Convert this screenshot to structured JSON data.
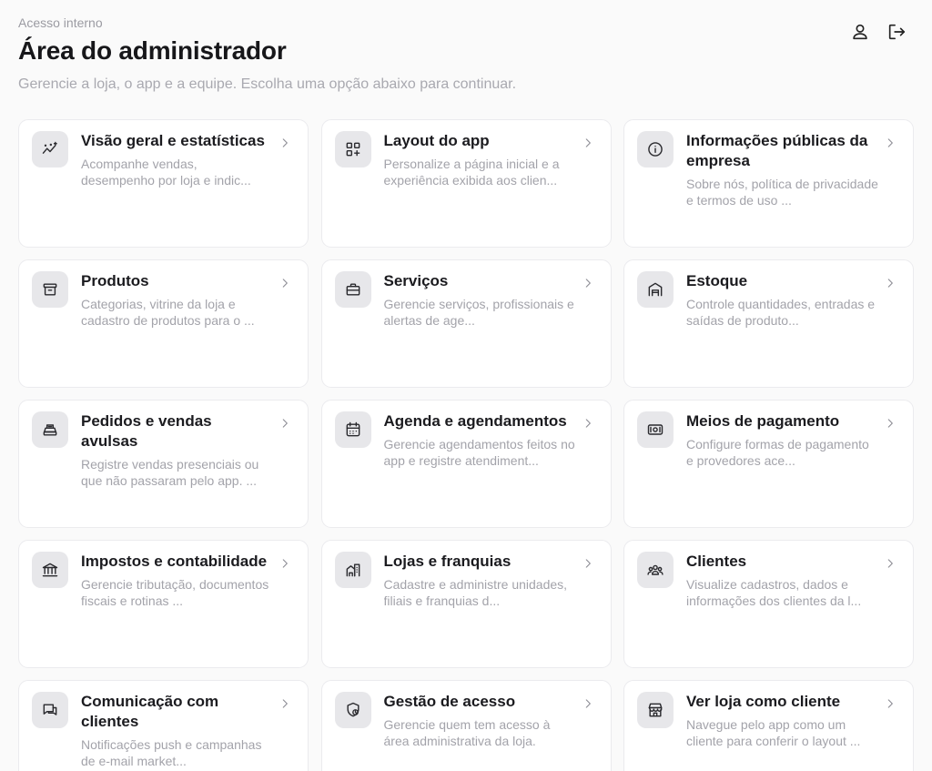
{
  "header": {
    "eyebrow": "Acesso interno",
    "title": "Área do administrador",
    "subtitle": "Gerencie a loja, o app e a equipe. Escolha uma opção abaixo para continuar."
  },
  "cards": [
    {
      "title": "Visão geral e estatísticas",
      "description": "Acompanhe vendas, desempenho por loja e indic...",
      "icon": "chart-icon"
    },
    {
      "title": "Layout do app",
      "description": "Personalize a página inicial e a experiência exibida aos clien...",
      "icon": "grid-plus-icon"
    },
    {
      "title": "Informações públicas da empresa",
      "description": "Sobre nós, política de privacidade e termos de uso ...",
      "icon": "info-icon"
    },
    {
      "title": "Produtos",
      "description": "Categorias, vitrine da loja e cadastro de produtos para o ...",
      "icon": "archive-icon"
    },
    {
      "title": "Serviços",
      "description": "Gerencie serviços, profissionais e alertas de age...",
      "icon": "briefcase-icon"
    },
    {
      "title": "Estoque",
      "description": "Controle quantidades, entradas e saídas de produto...",
      "icon": "warehouse-icon"
    },
    {
      "title": "Pedidos e vendas avulsas",
      "description": "Registre vendas presenciais ou que não passaram pelo app. ...",
      "icon": "register-icon"
    },
    {
      "title": "Agenda e agendamentos",
      "description": "Gerencie agendamentos feitos no app e registre atendiment...",
      "icon": "calendar-icon"
    },
    {
      "title": "Meios de pagamento",
      "description": "Configure formas de pagamento e provedores ace...",
      "icon": "money-icon"
    },
    {
      "title": "Impostos e contabilidade",
      "description": "Gerencie tributação, documentos fiscais e rotinas ...",
      "icon": "bank-icon"
    },
    {
      "title": "Lojas e franquias",
      "description": "Cadastre e administre unidades, filiais e franquias d...",
      "icon": "buildings-icon"
    },
    {
      "title": "Clientes",
      "description": "Visualize cadastros, dados e informações dos clientes da l...",
      "icon": "users-icon"
    },
    {
      "title": "Comunicação com clientes",
      "description": "Notificações push e campanhas de e-mail market...",
      "icon": "chat-icon"
    },
    {
      "title": "Gestão de acesso",
      "description": "Gerencie quem tem acesso à área administrativa da loja.",
      "icon": "shield-lock-icon"
    },
    {
      "title": "Ver loja como cliente",
      "description": "Navegue pelo app como um cliente para conferir o layout ...",
      "icon": "store-icon"
    }
  ]
}
